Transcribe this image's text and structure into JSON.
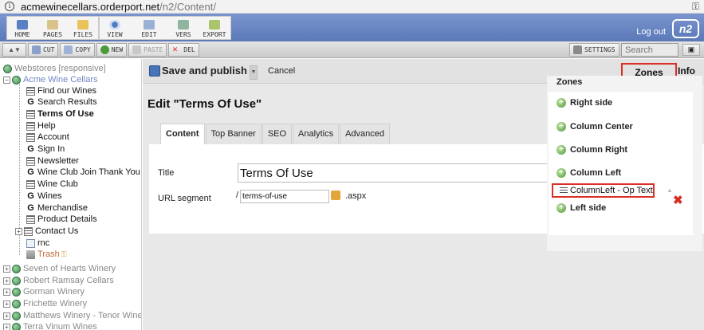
{
  "browser": {
    "host": "acmewinecellars.orderport.net",
    "path": "/n2/Content/"
  },
  "toolbar": {
    "group1": [
      "HOME",
      "PAGES",
      "FILES"
    ],
    "group2": [
      "VIEW",
      "EDIT",
      "VERS",
      "EXPORT"
    ],
    "logout": "Log out",
    "logo": "n2"
  },
  "subtoolbar": {
    "cut": "CUT",
    "copy": "COPY",
    "new": "NEW",
    "paste": "PASTE",
    "del": "DEL",
    "settings": "SETTINGS",
    "search_placeholder": "Search"
  },
  "tree": {
    "root": "Webstores [responsive]",
    "site": "Acme Wine Cellars",
    "pages": [
      "Find our Wines",
      "Search Results",
      "Terms Of Use",
      "Help",
      "Account",
      "Sign In",
      "Newsletter",
      "Wine Club Join Thank You",
      "Wine Club",
      "Wines",
      "Merchandise",
      "Product Details",
      "Contact Us",
      "rnc",
      "Trash"
    ],
    "other_sites": [
      "Seven of Hearts Winery",
      "Robert Ramsay Cellars",
      "Gorman Winery",
      "Frichette Winery",
      "Matthews Winery - Tenor Wine",
      "Terra Vinum Wines"
    ]
  },
  "actions": {
    "save": "Save and publish",
    "cancel": "Cancel",
    "zones": "Zones",
    "info": "Info"
  },
  "editor": {
    "heading": "Edit \"Terms Of Use\"",
    "tabs": [
      "Content",
      "Top Banner",
      "SEO",
      "Analytics",
      "Advanced"
    ],
    "title_label": "Title",
    "title_value": "Terms Of Use",
    "url_label": "URL segment",
    "url_prefix": "/",
    "url_value": "terms-of-use",
    "url_suffix": ".aspx"
  },
  "zones": {
    "header": "Zones",
    "items": [
      "Right side",
      "Column Center",
      "Column Right",
      "Column Left",
      "Left side"
    ],
    "part": "ColumnLeft - Op Text"
  },
  "colors": {
    "toolbar": "#5b78b8",
    "highlight": "#d93025",
    "link": "#6f86c6"
  }
}
